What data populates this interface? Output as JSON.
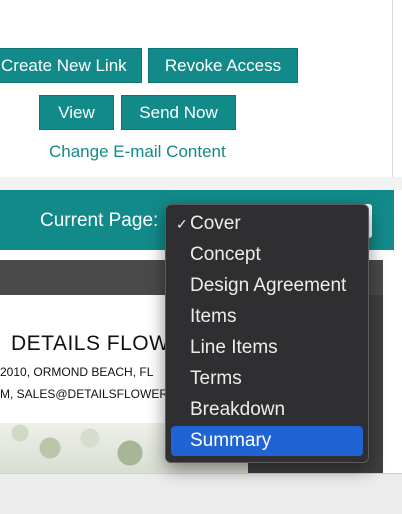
{
  "actions": {
    "create_new_link": "Create New Link",
    "revoke_access": "Revoke Access",
    "view": "View",
    "send_now": "Send Now",
    "change_email": "Change E-mail Content"
  },
  "page_selector": {
    "label": "Current Page:",
    "checked_item": "Cover",
    "highlighted_item": "Summary",
    "check_mark": "✓",
    "options": [
      "Cover",
      "Concept",
      "Design Agreement",
      "Items",
      "Line Items",
      "Terms",
      "Breakdown",
      "Summary"
    ]
  },
  "preview": {
    "title": "DETAILS FLOW",
    "address_line": "2010, ORMOND BEACH, FL",
    "contact_line": "M, SALES@DETAILSFLOWERS"
  },
  "colors": {
    "accent": "#138a8a",
    "menu_bg": "#2f2f31",
    "menu_highlight": "#1f63d4"
  }
}
